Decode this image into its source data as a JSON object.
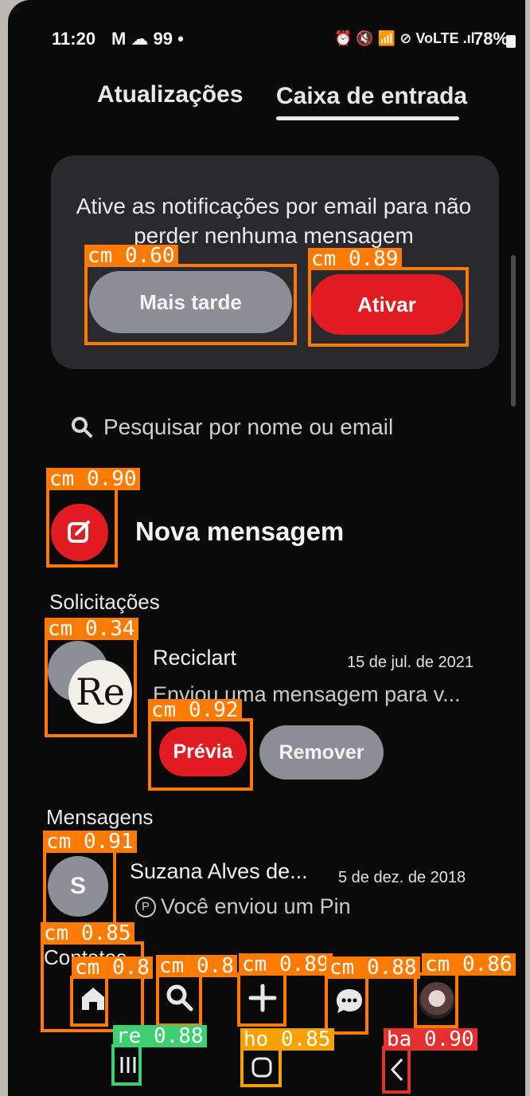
{
  "status": {
    "time": "11:20",
    "notif_icons": "M ☁ 99 •",
    "right_icons": "⏰ 🔇 📶 ⊘ VoLTE .ıl",
    "battery": "78%"
  },
  "tabs": {
    "updates": "Atualizações",
    "inbox": "Caixa de entrada"
  },
  "email_card": {
    "message": "Ative as notificações por email para não perder nenhuma mensagem",
    "later": "Mais tarde",
    "activate": "Ativar"
  },
  "search": {
    "placeholder": "Pesquisar por nome ou email"
  },
  "new_message": {
    "label": "Nova mensagem"
  },
  "requests": {
    "heading": "Solicitações",
    "item": {
      "avatar_text": "Re",
      "name": "Reciclart",
      "date": "15 de jul. de 2021",
      "preview": "Enviou uma mensagem para v...",
      "preview_button": "Prévia",
      "remove_button": "Remover"
    }
  },
  "messages": {
    "heading": "Mensagens",
    "item": {
      "avatar_letter": "S",
      "name": "Suzana Alves de...",
      "date": "5 de dez. de 2018",
      "preview": "Você enviou um Pin"
    }
  },
  "contacts_label": "Contatos",
  "overlay": {
    "later": "cm 0.60",
    "activate": "cm 0.89",
    "compose": "cm 0.90",
    "req_avatar": "cm 0.34",
    "preview": "cm 0.92",
    "msg_avatar": "cm 0.91",
    "contacts": "cm 0.85",
    "home": "cm 0.8",
    "search": "cm 0.8",
    "add": "cm 0.89",
    "chat": "cm 0.88",
    "profile": "cm 0.86",
    "recents": "re 0.88",
    "homebtn": "ho 0.85",
    "back": "ba 0.90"
  },
  "colors": {
    "accent": "#e21a22",
    "box_orange": "#ff7a00",
    "box_green": "#3cd070",
    "box_yellow": "#f5a100",
    "box_red": "#e53030"
  }
}
